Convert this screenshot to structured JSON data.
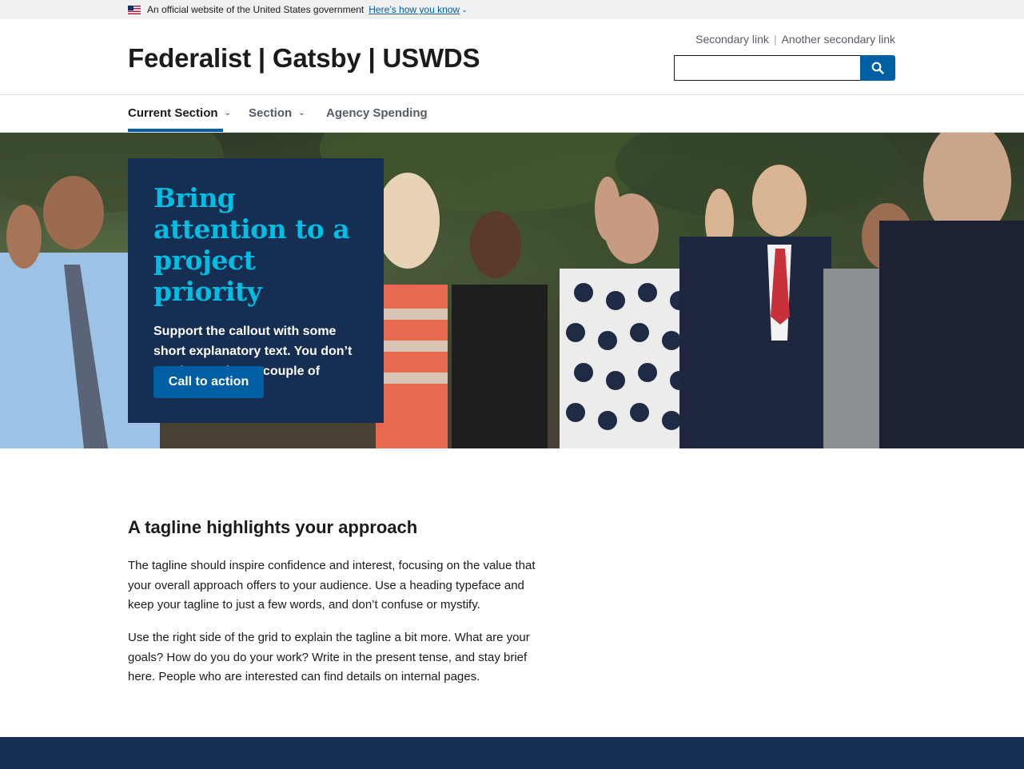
{
  "gov_banner": {
    "text": "An official website of the United States government",
    "link": "Here’s how you know",
    "flag_icon": "us-flag-icon"
  },
  "header": {
    "title": "Federalist | Gatsby | USWDS",
    "secondary_links": [
      "Secondary link",
      "Another secondary link"
    ],
    "search": {
      "value": "",
      "icon": "search-icon"
    }
  },
  "nav": {
    "items": [
      {
        "label": "Current Section",
        "has_dropdown": true,
        "current": true
      },
      {
        "label": "Section",
        "has_dropdown": true,
        "current": false
      },
      {
        "label": "Agency Spending",
        "has_dropdown": false,
        "current": false
      }
    ]
  },
  "hero": {
    "heading": "Bring attention to a project priority",
    "text": "Support the callout with some short explanatory text. You don’t need more than a couple of sentences.",
    "cta": "Call to action"
  },
  "tagline": {
    "heading": "A tagline highlights your approach",
    "p1": "The tagline should inspire confidence and interest, focusing on the value that your overall approach offers to your audience. Use a heading typeface and keep your tagline to just a few words, and don’t confuse or mystify.",
    "p2": "Use the right side of the grid to explain the tagline a bit more. What are your goals? How do you do your work? Write in the present tense, and stay brief here. People who are interested can find details on internal pages."
  },
  "colors": {
    "primary": "#005ea2",
    "primary_darker": "#162e51",
    "accent_cyan": "#00bde3",
    "banner_bg": "#f0f0f0"
  }
}
